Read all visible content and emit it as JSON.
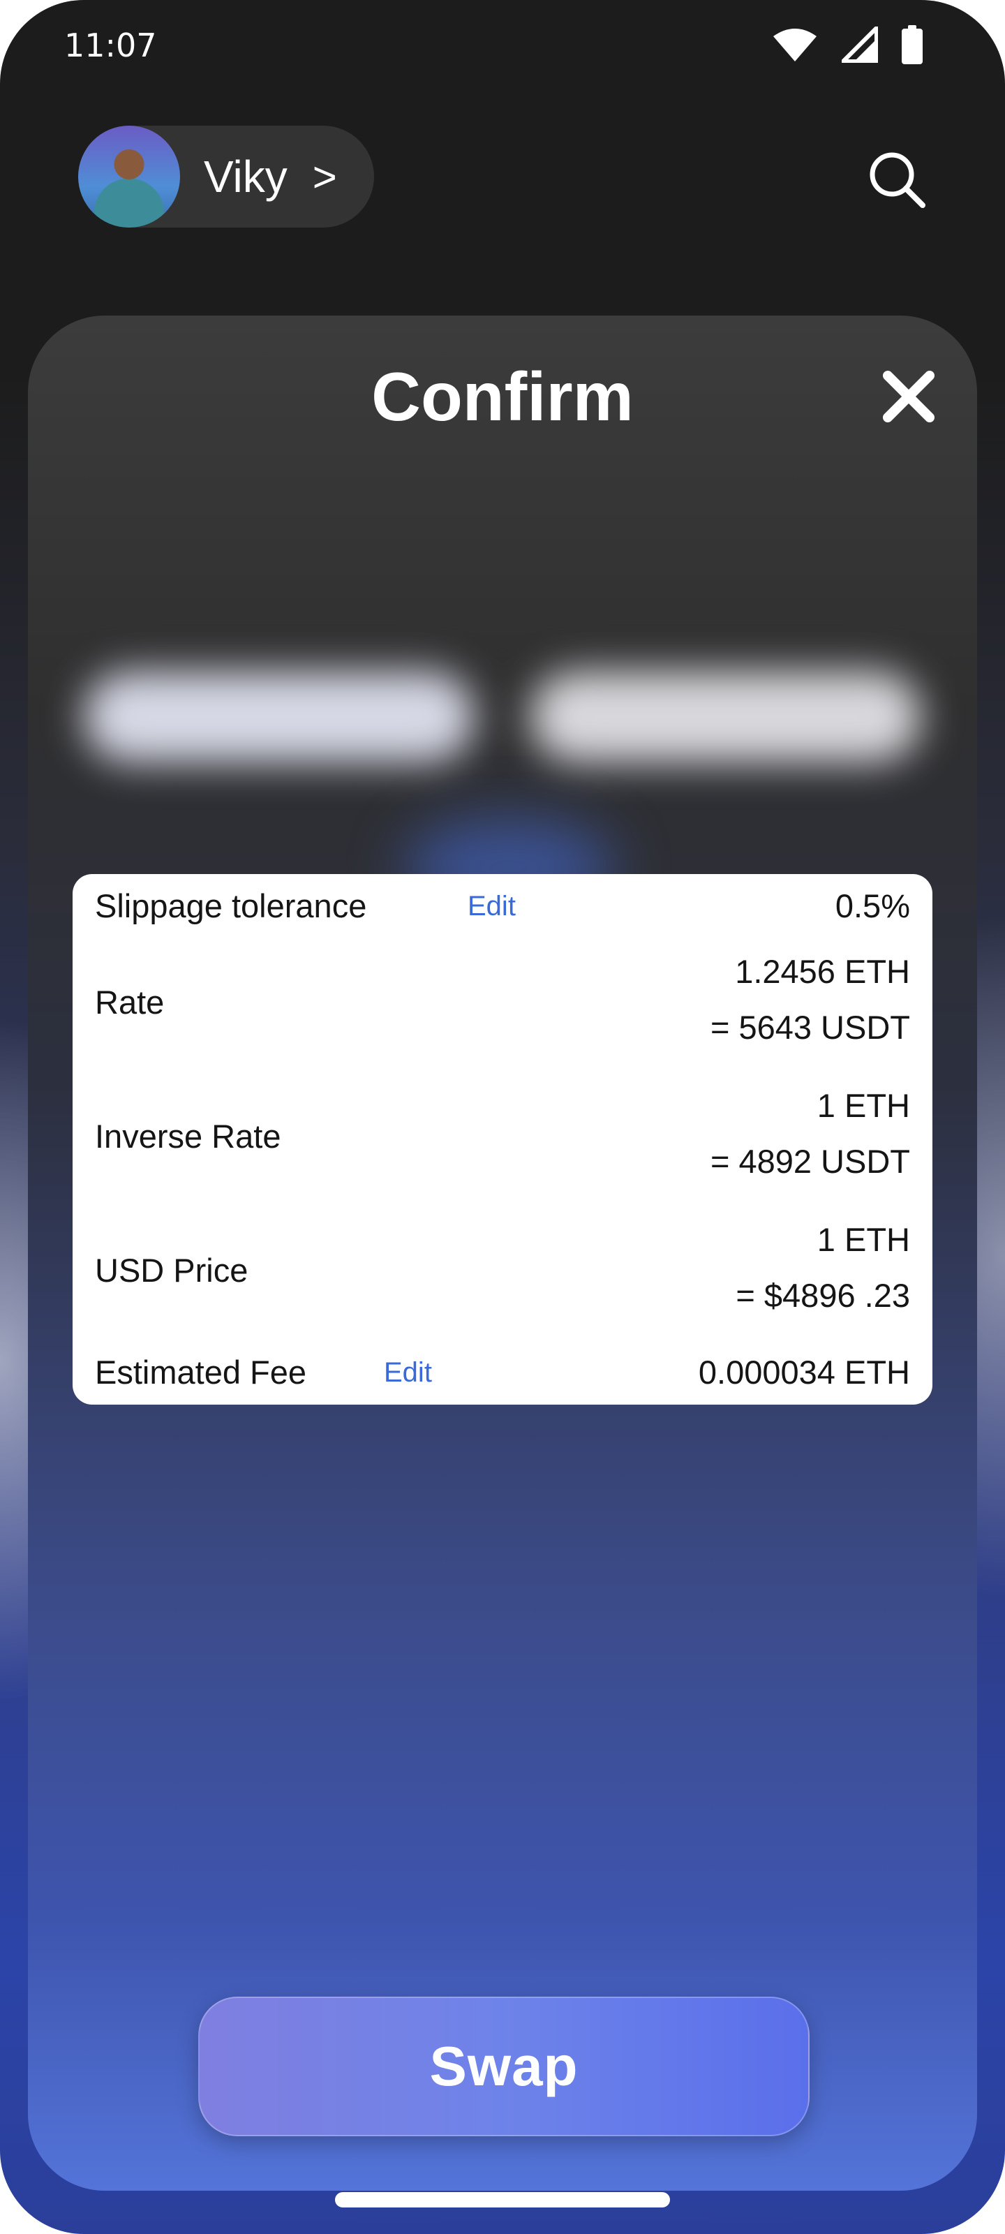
{
  "status_bar": {
    "time": "11:07",
    "icons": [
      "wifi-icon",
      "signal-icon",
      "battery-icon"
    ]
  },
  "header": {
    "profile_name": "Viky",
    "profile_chevron": ">",
    "search_icon": "search-icon"
  },
  "confirm_sheet": {
    "title": "Confirm",
    "close_icon": "close-icon",
    "details": {
      "slippage": {
        "label": "Slippage tolerance",
        "edit": "Edit",
        "value": "0.5%"
      },
      "rate": {
        "label": "Rate",
        "value_line1": "1.2456 ETH",
        "value_line2": "= 5643 USDT"
      },
      "inverse_rate": {
        "label": "Inverse Rate",
        "value_line1": "1 ETH",
        "value_line2": "= 4892 USDT"
      },
      "usd_price": {
        "label": "USD Price",
        "value_line1": "1 ETH",
        "value_line2": "= $4896 .23"
      },
      "estimated_fee": {
        "label": "Estimated Fee",
        "edit": "Edit",
        "value": "0.000034 ETH"
      }
    },
    "swap_button": "Swap"
  },
  "colors": {
    "accent_link": "#3a6ad8",
    "swap_gradient_start": "#7f7fe0",
    "swap_gradient_end": "#5a6fea",
    "sheet_bg_top": "#3c3c3c",
    "background_top": "#1c1c1c"
  }
}
